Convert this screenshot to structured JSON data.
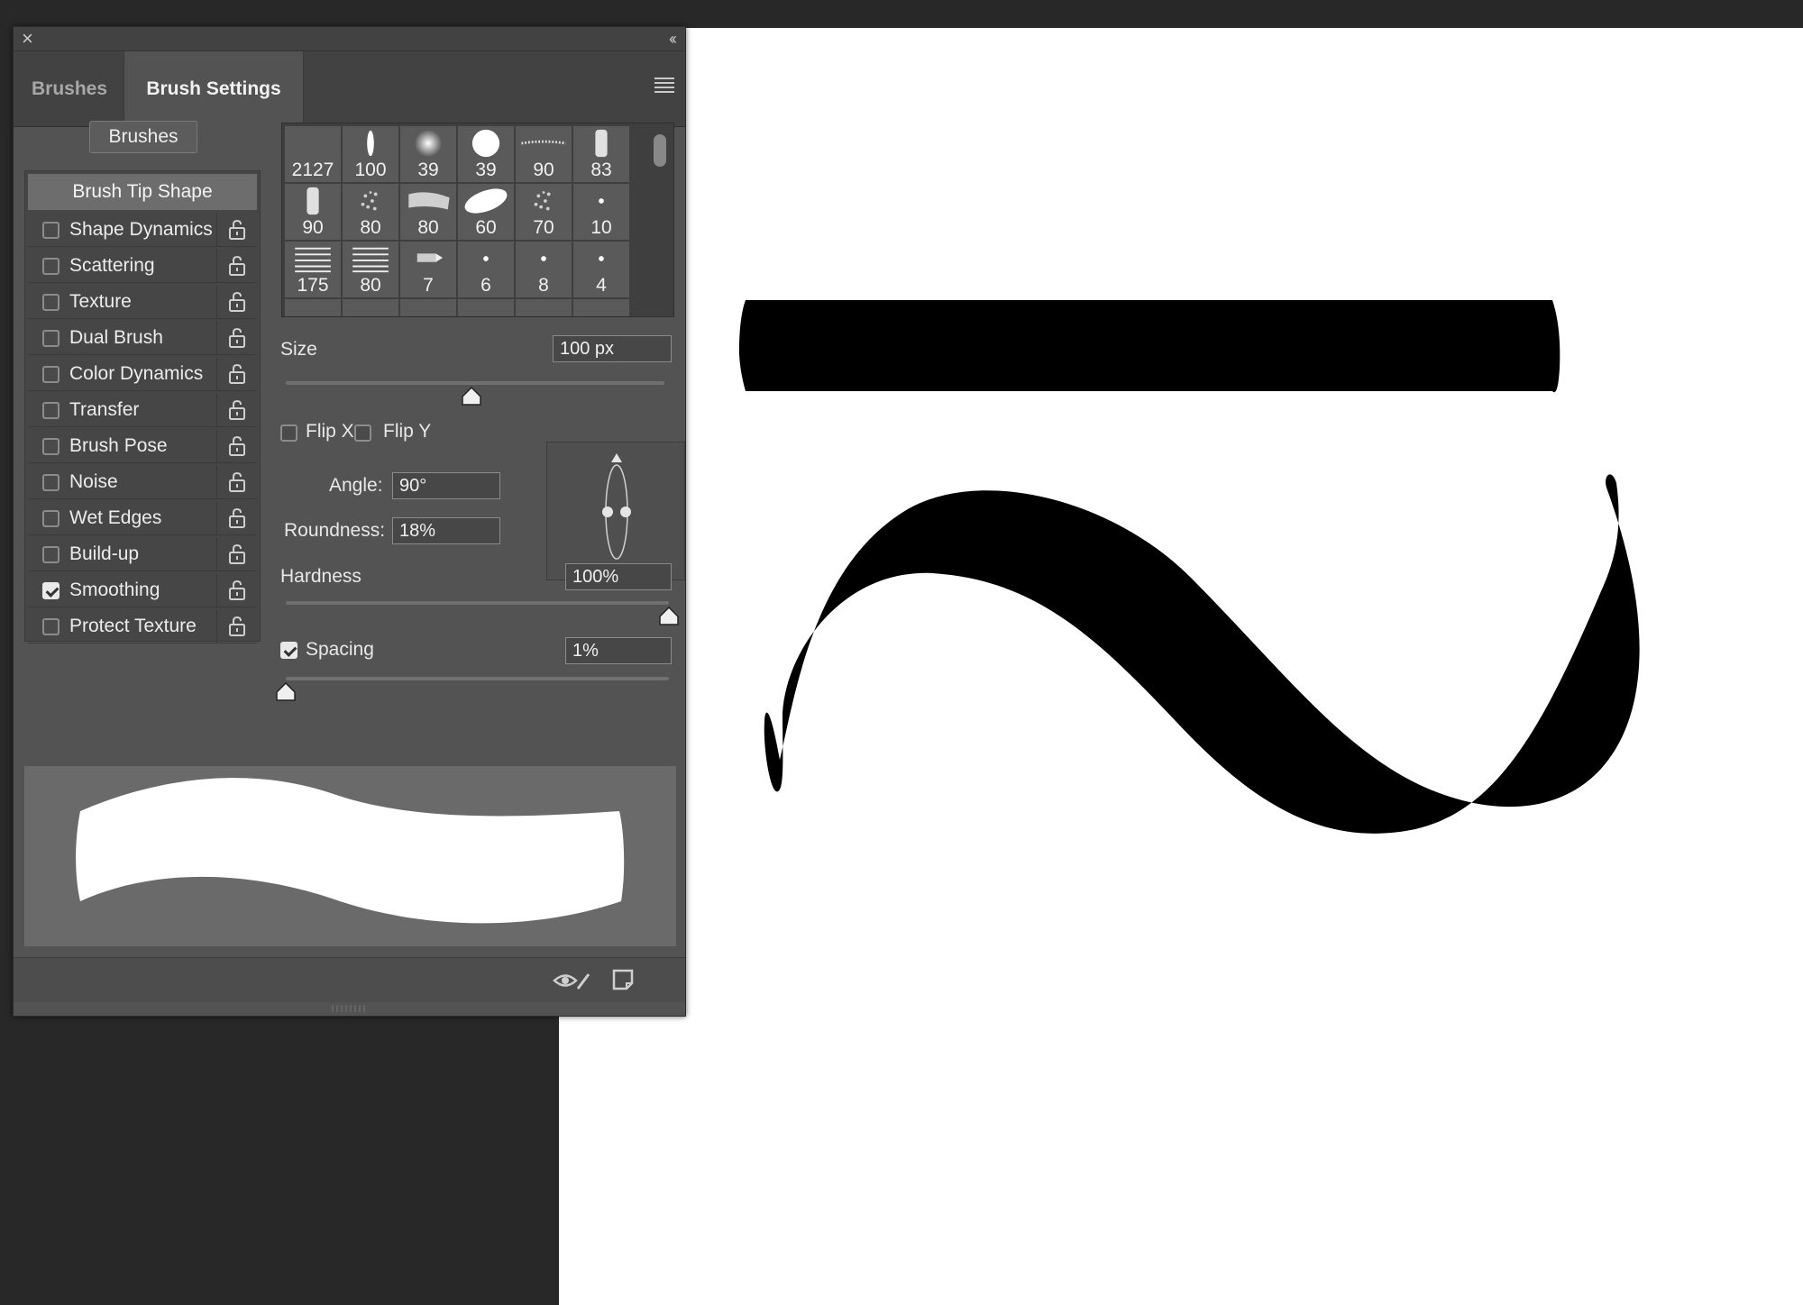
{
  "panel": {
    "tabs": [
      "Brushes",
      "Brush Settings"
    ],
    "brushes_button": "Brushes",
    "tip_shape_label": "Brush Tip Shape",
    "options": [
      {
        "label": "Shape Dynamics",
        "checked": false
      },
      {
        "label": "Scattering",
        "checked": false
      },
      {
        "label": "Texture",
        "checked": false
      },
      {
        "label": "Dual Brush",
        "checked": false
      },
      {
        "label": "Color Dynamics",
        "checked": false
      },
      {
        "label": "Transfer",
        "checked": false
      },
      {
        "label": "Brush Pose",
        "checked": false
      },
      {
        "label": "Noise",
        "checked": false
      },
      {
        "label": "Wet Edges",
        "checked": false
      },
      {
        "label": "Build-up",
        "checked": false
      },
      {
        "label": "Smoothing",
        "checked": true
      },
      {
        "label": "Protect Texture",
        "checked": false
      }
    ],
    "presets": [
      {
        "size": "2127",
        "kind": "blank"
      },
      {
        "size": "100",
        "kind": "ellipse"
      },
      {
        "size": "39",
        "kind": "soft"
      },
      {
        "size": "39",
        "kind": "hard"
      },
      {
        "size": "90",
        "kind": "dots"
      },
      {
        "size": "83",
        "kind": "chalk"
      },
      {
        "size": "90",
        "kind": "chalk"
      },
      {
        "size": "80",
        "kind": "spray"
      },
      {
        "size": "80",
        "kind": "stroke"
      },
      {
        "size": "60",
        "kind": "blob"
      },
      {
        "size": "70",
        "kind": "spray"
      },
      {
        "size": "10",
        "kind": "dot"
      },
      {
        "size": "175",
        "kind": "lines"
      },
      {
        "size": "80",
        "kind": "lines"
      },
      {
        "size": "7",
        "kind": "pencil"
      },
      {
        "size": "6",
        "kind": "dot"
      },
      {
        "size": "8",
        "kind": "dot"
      },
      {
        "size": "4",
        "kind": "dot"
      }
    ],
    "size": {
      "label": "Size",
      "value": "100 px",
      "slider": 0.49
    },
    "flip_x": {
      "label": "Flip X",
      "checked": false
    },
    "flip_y": {
      "label": "Flip Y",
      "checked": false
    },
    "angle": {
      "label": "Angle:",
      "value": "90°"
    },
    "roundness": {
      "label": "Roundness:",
      "value": "18%"
    },
    "hardness": {
      "label": "Hardness",
      "value": "100%",
      "slider": 1.0
    },
    "spacing": {
      "label": "Spacing",
      "value": "1%",
      "checked": true,
      "slider": 0.0
    },
    "footer_icons": [
      "eye-brush-icon",
      "new-preset-icon"
    ]
  },
  "colors": {
    "panel_bg": "#535353",
    "canvas_bg": "#ffffff",
    "stroke": "#000000"
  }
}
